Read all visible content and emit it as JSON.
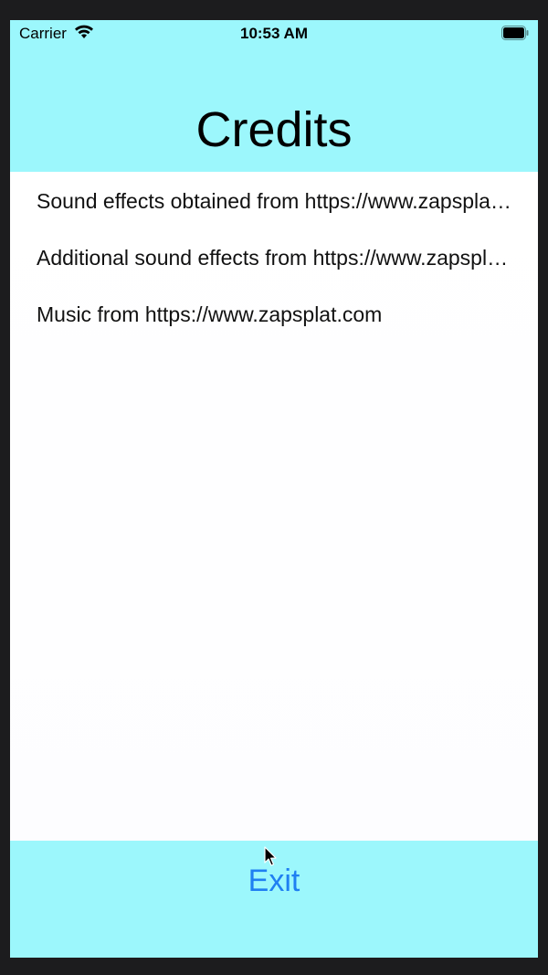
{
  "status_bar": {
    "carrier": "Carrier",
    "time": "10:53 AM",
    "wifi_icon": "wifi-icon",
    "battery_icon": "battery-icon"
  },
  "header": {
    "title": "Credits"
  },
  "credits": [
    {
      "text": "Sound effects obtained from https://www.zapsplat.com"
    },
    {
      "text": "Additional sound effects from https://www.zapsplat.com"
    },
    {
      "text": "Music from https://www.zapsplat.com"
    }
  ],
  "footer": {
    "exit_label": "Exit"
  },
  "colors": {
    "header_bg": "#9cf7fc",
    "accent": "#1f7ff2",
    "frame": "#1c1c1e"
  }
}
